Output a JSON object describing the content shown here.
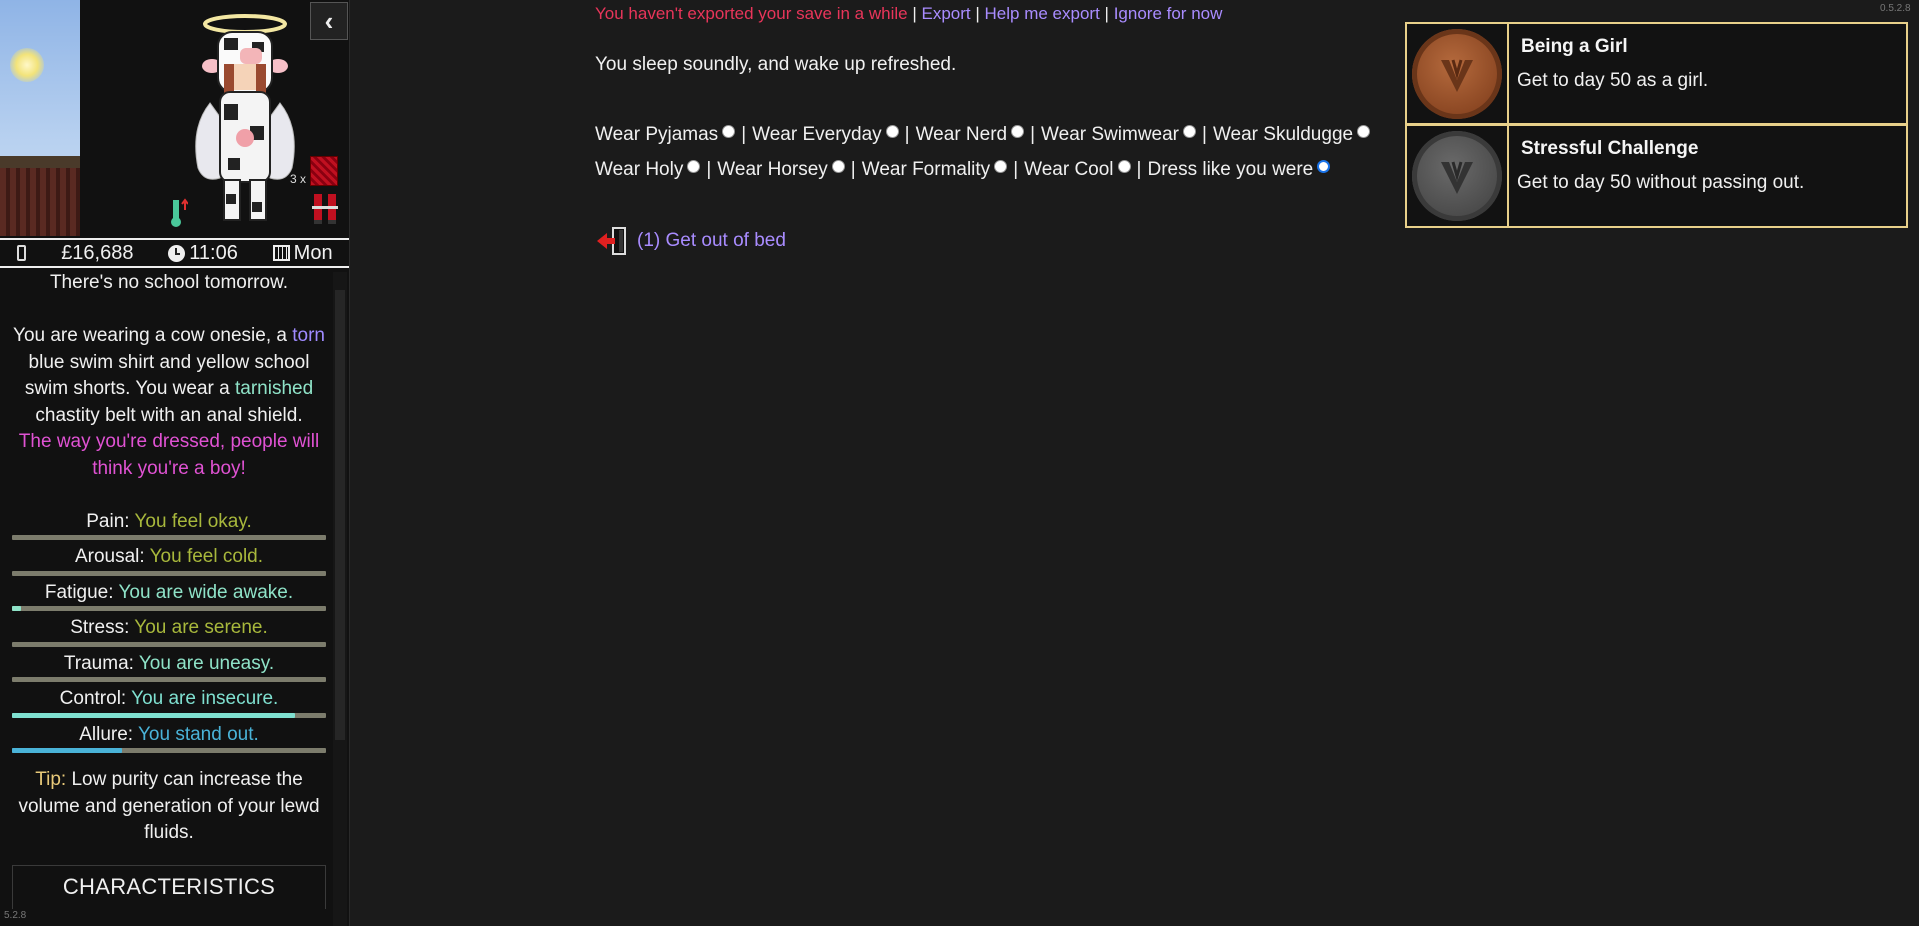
{
  "topbar": {
    "export_warning": "You haven't exported your save in a while",
    "sep1": "|",
    "export_link": "Export",
    "sep2": "|",
    "help_link": "Help me export",
    "sep3": "|",
    "ignore_link": "Ignore for now"
  },
  "main": {
    "sleep_text": "You sleep soundly, and wake up refreshed.",
    "wear_options_row1": [
      {
        "label": "Wear Pyjamas",
        "checked": false
      },
      {
        "label": "Wear Everyday",
        "checked": false
      },
      {
        "label": "Wear Nerd",
        "checked": false
      },
      {
        "label": "Wear Swimwear",
        "checked": false
      },
      {
        "label": "Wear Skuldugge",
        "checked": false
      }
    ],
    "wear_options_row2": [
      {
        "label": "Wear Holy",
        "checked": false
      },
      {
        "label": "Wear Horsey",
        "checked": false
      },
      {
        "label": "Wear Formality",
        "checked": false
      },
      {
        "label": "Wear Cool",
        "checked": false
      },
      {
        "label": "Dress like you were",
        "checked": true
      }
    ],
    "separator": "|",
    "bed_action_label": "(1) Get out of bed",
    "bed_action_icon": "exit-door-icon"
  },
  "achievements": [
    {
      "title": "Being a Girl",
      "description": "Get to day 50 as a girl.",
      "medal": "bronze-medal-icon",
      "medal_color": "#8a4622"
    },
    {
      "title": "Stressful Challenge",
      "description": "Get to day 50 without passing out.",
      "medal": "silver-medal-icon",
      "medal_color": "#4a4a4a"
    }
  ],
  "version_right": "0.5.2.8",
  "sidebar": {
    "collapse_icon": "chevron-left-icon",
    "item_count": "3 x",
    "money": "£16,688",
    "time": "11:06",
    "day": "Mon",
    "school_text": "There's no school tomorrow.",
    "clothing": {
      "p1": "You are wearing a cow onesie, a",
      "torn": "torn",
      "p2": "blue swim shirt and yellow school swim shorts. You wear a",
      "tarnished": "tarnished",
      "p3": "chastity belt with an anal shield.",
      "gender_note": "The way you're dressed, people will think you're a boy!"
    },
    "stats": [
      {
        "label": "Pain:",
        "value": "You feel okay.",
        "color": "#a8b83c",
        "fill": 0.0,
        "fill_color": "#a8b83c"
      },
      {
        "label": "Arousal:",
        "value": "You feel cold.",
        "color": "#a8b83c",
        "fill": 0.0,
        "fill_color": "#a8b83c"
      },
      {
        "label": "Fatigue:",
        "value": "You are wide awake.",
        "color": "#8fe3c8",
        "fill": 0.03,
        "fill_color": "#8fe3c8"
      },
      {
        "label": "Stress:",
        "value": "You are serene.",
        "color": "#a8b83c",
        "fill": 0.0,
        "fill_color": "#a8b83c"
      },
      {
        "label": "Trauma:",
        "value": "You are uneasy.",
        "color": "#8fe3c8",
        "fill": 0.0,
        "fill_color": "#8fe3c8"
      },
      {
        "label": "Control:",
        "value": "You are insecure.",
        "color": "#7fe0d0",
        "fill": 0.9,
        "fill_color": "#7fe0d0"
      },
      {
        "label": "Allure:",
        "value": "You stand out.",
        "color": "#4ab3d8",
        "fill": 0.35,
        "fill_color": "#4ab3d8"
      }
    ],
    "tip_label": "Tip:",
    "tip_text": "Low purity can increase the volume and generation of your lewd fluids.",
    "characteristics": "CHARACTERISTICS",
    "version_left": "5.2.8"
  }
}
